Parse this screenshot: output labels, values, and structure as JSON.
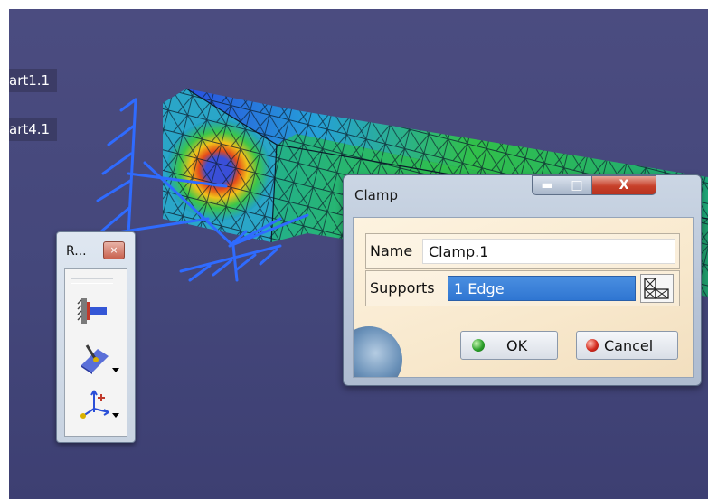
{
  "tree": {
    "items": [
      {
        "label": "art1.1"
      },
      {
        "label": "art4.1"
      }
    ]
  },
  "toolbar": {
    "title": "R...",
    "close_glyph": "×",
    "tools": [
      {
        "icon": "clamp-restraint-icon",
        "has_dropdown": false
      },
      {
        "icon": "surface-slider-icon",
        "has_dropdown": true
      },
      {
        "icon": "user-defined-restraint-icon",
        "has_dropdown": true
      }
    ]
  },
  "dialog": {
    "title": "Clamp",
    "min_glyph": "▬",
    "max_glyph": "□",
    "close_glyph": "X",
    "name_label": "Name",
    "name_value": "Clamp.1",
    "supports_label": "Supports",
    "supports_value": "1 Edge",
    "ok_label": "OK",
    "cancel_label": "Cancel"
  },
  "colors": {
    "viewport_bg": "#44477b",
    "restraint_lines": "#2f6bff",
    "selection": "#2f76d2",
    "ok_green": "#2da02c",
    "cancel_red": "#d42b1f"
  }
}
